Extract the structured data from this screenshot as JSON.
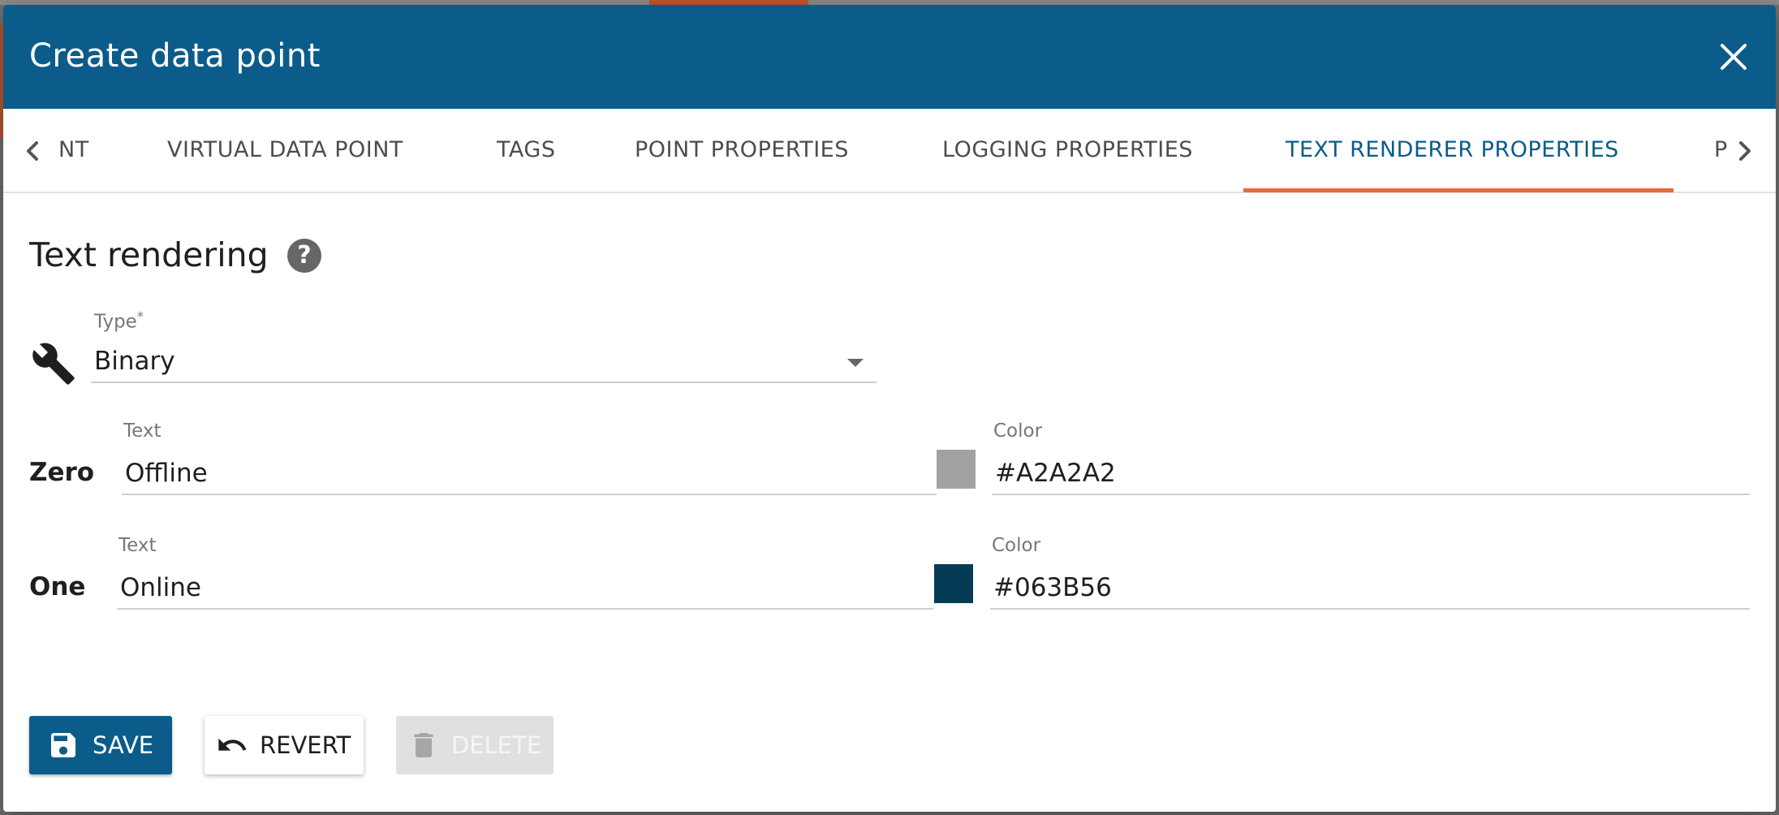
{
  "dialog": {
    "title": "Create data point",
    "close_icon": "close-icon"
  },
  "tabs": [
    {
      "label": "NT"
    },
    {
      "label": "VIRTUAL DATA POINT"
    },
    {
      "label": "TAGS"
    },
    {
      "label": "POINT PROPERTIES"
    },
    {
      "label": "LOGGING PROPERTIES"
    },
    {
      "label": "TEXT RENDERER PROPERTIES",
      "active": true
    },
    {
      "label": "P"
    }
  ],
  "section": {
    "title": "Text rendering",
    "help_icon": "help-icon",
    "help_glyph": "?"
  },
  "type_field": {
    "label": "Type",
    "required_mark": "*",
    "value": "Binary",
    "icon": "wrench-icon"
  },
  "zero": {
    "label": "Zero",
    "text_label": "Text",
    "text_value": "Offline",
    "color_label": "Color",
    "color_value": "#A2A2A2",
    "swatch_color": "#A2A2A2"
  },
  "one": {
    "label": "One",
    "text_label": "Text",
    "text_value": "Online",
    "color_label": "Color",
    "color_value": "#063B56",
    "swatch_color": "#063B56"
  },
  "buttons": {
    "save": "SAVE",
    "revert": "REVERT",
    "delete": "DELETE"
  },
  "colors": {
    "primary": "#0b5c8a",
    "accent": "#e76a3d"
  }
}
